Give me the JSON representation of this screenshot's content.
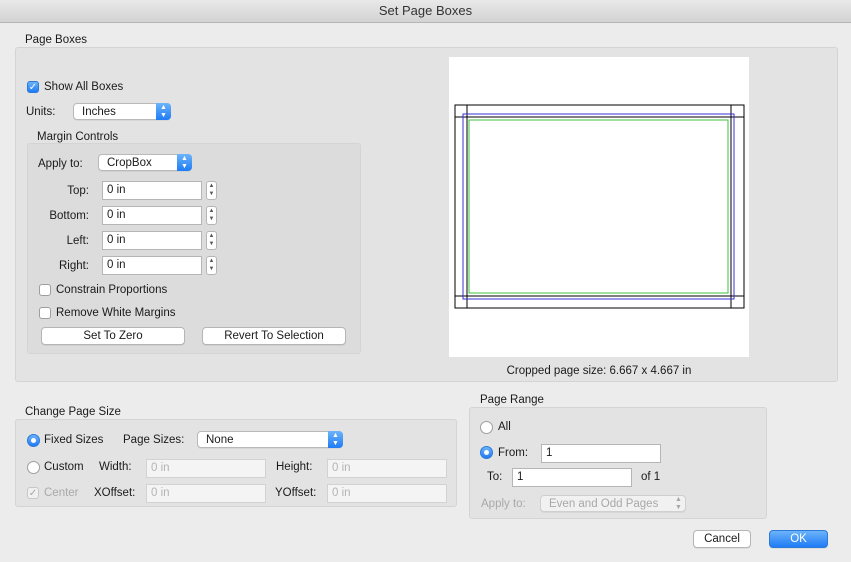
{
  "window": {
    "title": "Set Page Boxes"
  },
  "page_boxes": {
    "title": "Page Boxes",
    "show_all_boxes": {
      "label": "Show All Boxes",
      "checked": true
    },
    "units": {
      "label": "Units:",
      "value": "Inches"
    },
    "margin_controls": {
      "title": "Margin Controls",
      "apply_to": {
        "label": "Apply to:",
        "value": "CropBox"
      },
      "fields": [
        {
          "label": "Top:",
          "value": "0 in"
        },
        {
          "label": "Bottom:",
          "value": "0 in"
        },
        {
          "label": "Left:",
          "value": "0 in"
        },
        {
          "label": "Right:",
          "value": "0 in"
        }
      ],
      "constrain_proportions": {
        "label": "Constrain Proportions",
        "checked": false
      },
      "remove_white_margins": {
        "label": "Remove White Margins",
        "checked": false
      },
      "set_to_zero": "Set To Zero",
      "revert_to_selection": "Revert To Selection"
    },
    "cropped_size": "Cropped page size: 6.667 x 4.667 in",
    "preview_colors": {
      "media": "#000000",
      "crop": "#3a2fd6",
      "trim": "#3ec23e"
    }
  },
  "change_page_size": {
    "title": "Change Page Size",
    "fixed_sizes": {
      "label": "Fixed Sizes",
      "selected": true
    },
    "page_sizes": {
      "label": "Page Sizes:",
      "value": "None"
    },
    "custom": {
      "label": "Custom",
      "selected": false
    },
    "width": {
      "label": "Width:",
      "placeholder": "0 in"
    },
    "height": {
      "label": "Height:",
      "placeholder": "0 in"
    },
    "center": {
      "label": "Center",
      "checked": true
    },
    "xoffset": {
      "label": "XOffset:",
      "placeholder": "0 in"
    },
    "yoffset": {
      "label": "YOffset:",
      "placeholder": "0 in"
    }
  },
  "page_range": {
    "title": "Page Range",
    "all": {
      "label": "All",
      "selected": false
    },
    "from": {
      "label": "From:",
      "value": "1",
      "selected": true
    },
    "to": {
      "label": "To:",
      "value": "1"
    },
    "of_total": "of 1",
    "apply_to": {
      "label": "Apply to:",
      "value": "Even and Odd Pages"
    }
  },
  "buttons": {
    "cancel": "Cancel",
    "ok": "OK"
  },
  "accent_color": "#1f7cf5"
}
